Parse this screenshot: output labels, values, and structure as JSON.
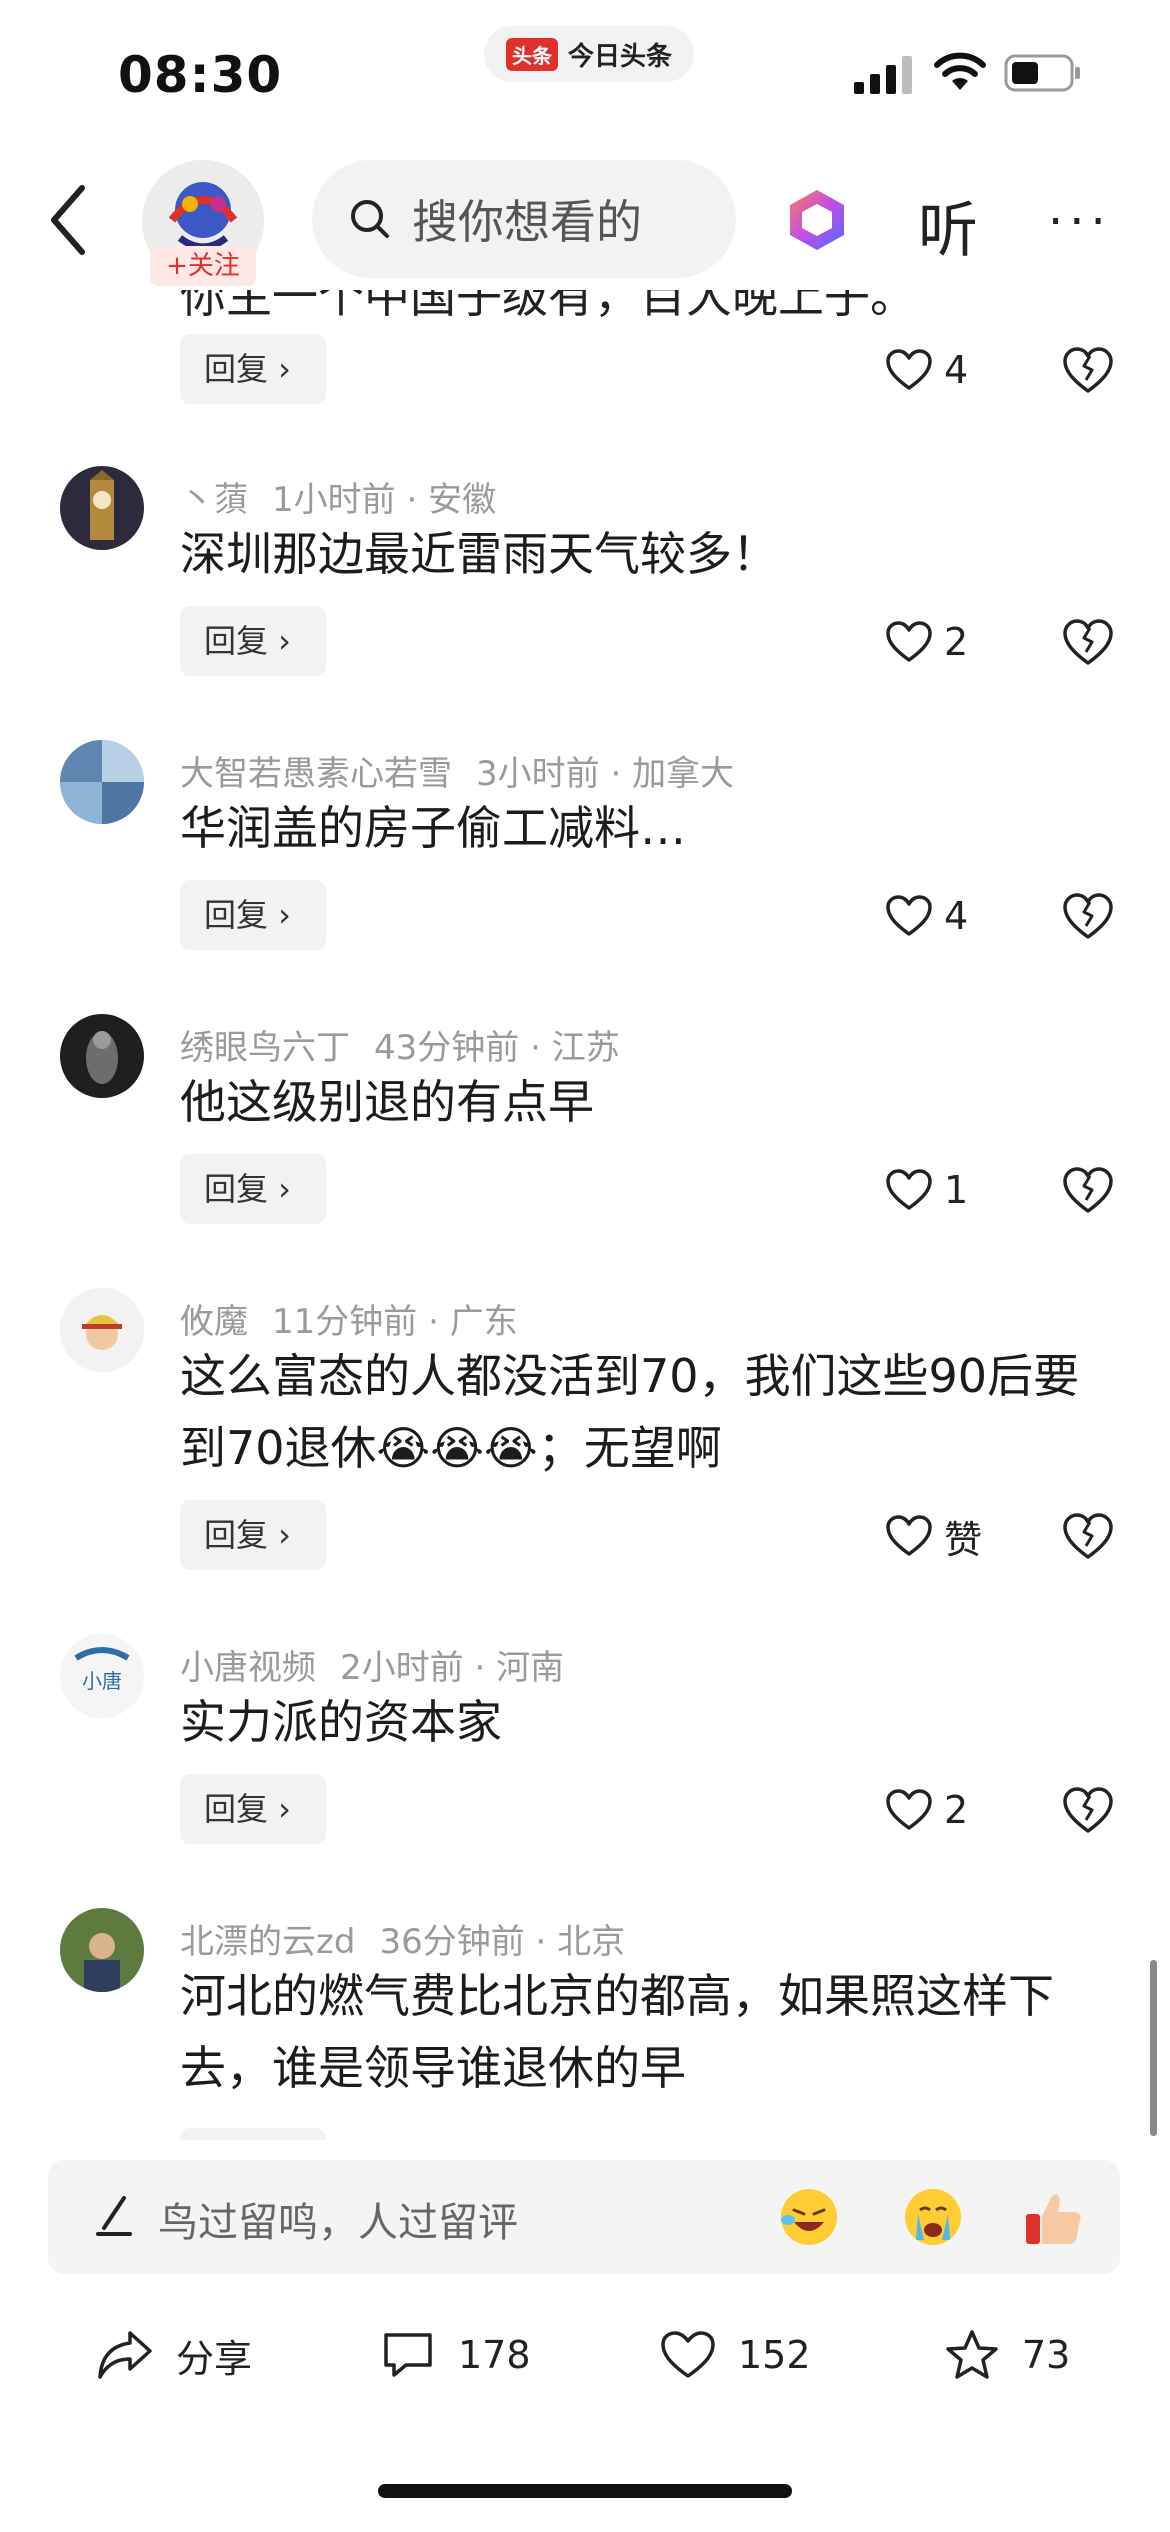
{
  "status_bar": {
    "time": "08:30",
    "app_pill_brand": "头条",
    "app_pill_name": "今日头条"
  },
  "nav": {
    "follow_label": "+关注",
    "search_placeholder": "搜你想看的",
    "listen_label": "听",
    "more_label": "···"
  },
  "clipped_text": "你主一个中国子级有，目大晚上子。",
  "top_partial": {
    "reply_label": "回复 ›",
    "like_count": "4"
  },
  "comments": [
    {
      "name": "丶蕦",
      "time": "1小时前",
      "location": "安徽",
      "text": "深圳那边最近雷雨天气较多！",
      "reply_label": "回复 ›",
      "likes": "2"
    },
    {
      "name": "大智若愚素心若雪",
      "time": "3小时前",
      "location": "加拿大",
      "text": "华润盖的房子偷工减料…",
      "reply_label": "回复 ›",
      "likes": "4"
    },
    {
      "name": "绣眼鸟六丁",
      "time": "43分钟前",
      "location": "江苏",
      "text": "他这级别退的有点早",
      "reply_label": "回复 ›",
      "likes": "1"
    },
    {
      "name": "攸魔",
      "time": "11分钟前",
      "location": "广东",
      "text": "这么富态的人都没活到70，我们这些90后要到70退休😭😭😭；无望啊",
      "reply_label": "回复 ›",
      "likes": "赞"
    },
    {
      "name": "小唐视频",
      "time": "2小时前",
      "location": "河南",
      "text": "实力派的资本家",
      "reply_label": "回复 ›",
      "likes": "2"
    },
    {
      "name": "北漂的云zd",
      "time": "36分钟前",
      "location": "北京",
      "text": "河北的燃气费比北京的都高，如果照这样下去，谁是领导谁退休的早"
    }
  ],
  "meta_separator": "·",
  "comment_input": {
    "placeholder": "鸟过留鸣，人过留评"
  },
  "actions": {
    "share_label": "分享",
    "comment_count": "178",
    "like_count": "152",
    "favorite_count": "73"
  },
  "colors": {
    "accent": "#e0302a",
    "meta": "#9a9a9a",
    "chip": "#f2f2f2"
  }
}
